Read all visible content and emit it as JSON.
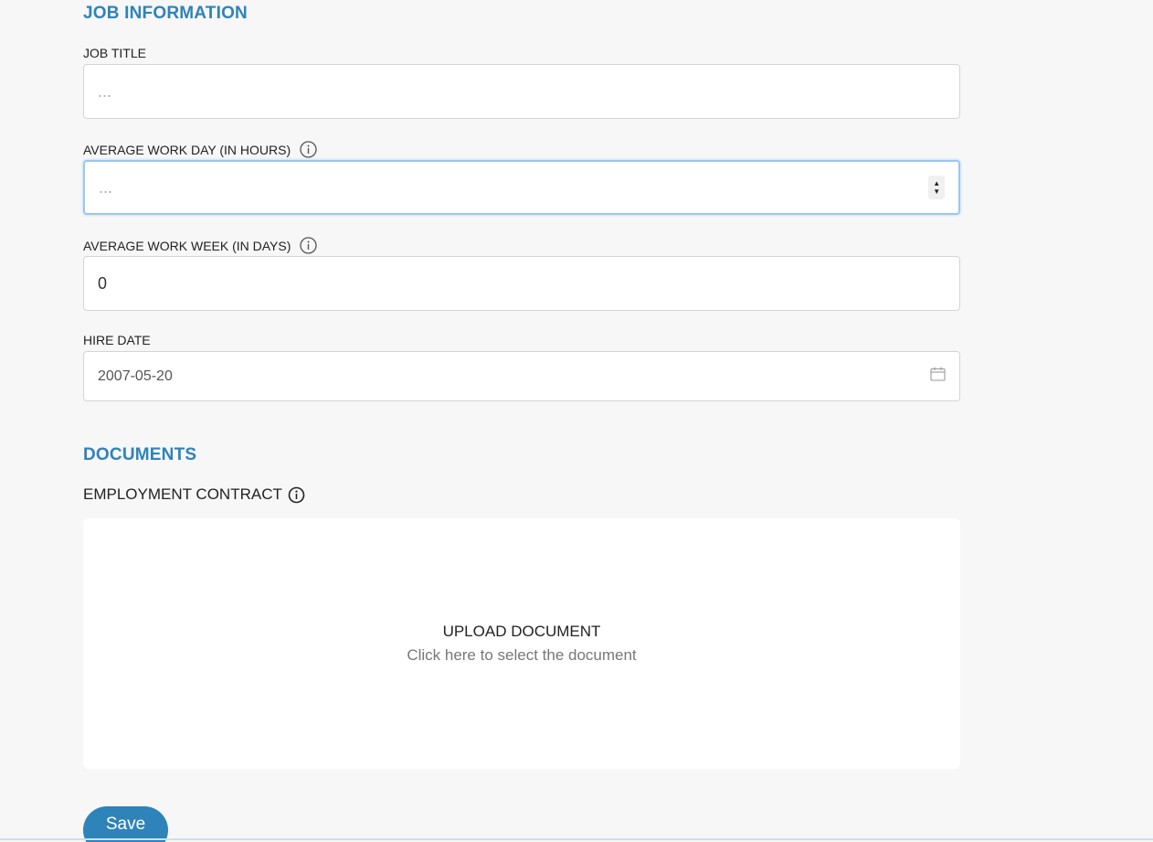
{
  "job_section": {
    "title": "JOB INFORMATION",
    "job_title": {
      "label": "JOB TITLE",
      "placeholder": "...",
      "value": ""
    },
    "work_day": {
      "label": "AVERAGE WORK DAY (IN HOURS)",
      "placeholder": "...",
      "value": ""
    },
    "work_week": {
      "label": "AVERAGE WORK WEEK (IN DAYS)",
      "value": "0"
    },
    "hire_date": {
      "label": "HIRE DATE",
      "value": "2007-05-20"
    }
  },
  "documents_section": {
    "title": "DOCUMENTS",
    "contract_label": "EMPLOYMENT CONTRACT",
    "upload_title": "UPLOAD DOCUMENT",
    "upload_subtitle": "Click here to select the document"
  },
  "save_label": "Save",
  "colors": {
    "accent": "#2e83b8",
    "focus_border": "#9cc6ee"
  },
  "icons": [
    "info-icon",
    "calendar-icon",
    "stepper-icon"
  ]
}
